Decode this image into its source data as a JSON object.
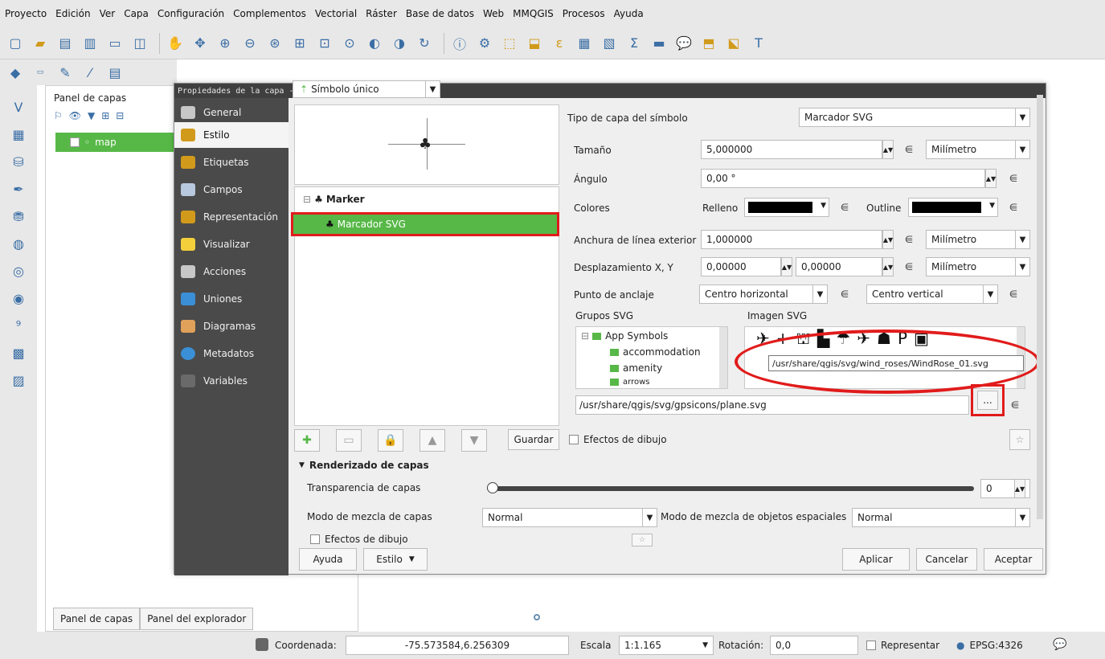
{
  "menubar": {
    "items": [
      "Proyecto",
      "Edición",
      "Ver",
      "Capa",
      "Configuración",
      "Complementos",
      "Vectorial",
      "Ráster",
      "Base de datos",
      "Web",
      "MMQGIS",
      "Procesos",
      "Ayuda"
    ]
  },
  "layers_panel": {
    "title": "Panel de capas",
    "layer_name": "map"
  },
  "bottom_tabs": [
    "Panel de capas",
    "Panel del explorador"
  ],
  "statusbar": {
    "coord_label": "Coordenada:",
    "coord_value": "-75.573584,6.256309",
    "scale_label": "Escala",
    "scale_value": "1:1.165",
    "rotation_label": "Rotación:",
    "rotation_value": "0,0",
    "render_label": "Representar",
    "epsg": "EPSG:4326"
  },
  "dialog": {
    "title": "Propiedades de la capa - map | Estilo",
    "nav": [
      "General",
      "Estilo",
      "Etiquetas",
      "Campos",
      "Representación",
      "Visualizar",
      "Acciones",
      "Uniones",
      "Diagramas",
      "Metadatos",
      "Variables"
    ],
    "renderer": "Símbolo único",
    "tree_marker": "Marker",
    "tree_selected": "Marcador SVG",
    "symbol_layer_type_label": "Tipo de capa del símbolo",
    "symbol_layer_type": "Marcador SVG",
    "size_label": "Tamaño",
    "size_value": "5,000000",
    "unit": "Milímetro",
    "angle_label": "Ángulo",
    "angle_value": "0,00 °",
    "colors_label": "Colores",
    "fill_label": "Relleno",
    "outline_label": "Outline",
    "outline_width_label": "Anchura de línea exterior",
    "outline_width_value": "1,000000",
    "offset_label": "Desplazamiento X, Y",
    "offset_x": "0,00000",
    "offset_y": "0,00000",
    "anchor_label": "Punto de anclaje",
    "anchor_h": "Centro horizontal",
    "anchor_v": "Centro vertical",
    "svg_groups_label": "Grupos SVG",
    "svg_image_label": "Imagen SVG",
    "groups": [
      "App Symbols",
      "accommodation",
      "amenity",
      "arrows"
    ],
    "tooltip": "/usr/share/qgis/svg/wind_roses/WindRose_01.svg",
    "svg_path": "/usr/share/qgis/svg/gpsicons/plane.svg",
    "browse_label": "...",
    "guardar": "Guardar",
    "draw_effects": "Efectos de dibujo",
    "render_header": "Renderizado de capas",
    "transparency_label": "Transparencia de capas",
    "transparency_value": "0",
    "blend_layer_label": "Modo de mezcla de capas",
    "blend_layer_value": "Normal",
    "blend_feature_label": "Modo de mezcla de objetos espaciales",
    "blend_feature_value": "Normal",
    "btn_help": "Ayuda",
    "btn_style": "Estilo",
    "btn_apply": "Aplicar",
    "btn_cancel": "Cancelar",
    "btn_accept": "Aceptar"
  },
  "colors": {
    "selection": "#57b847",
    "highlight": "#e11b1b",
    "nav_bg": "#4a4a4a"
  }
}
